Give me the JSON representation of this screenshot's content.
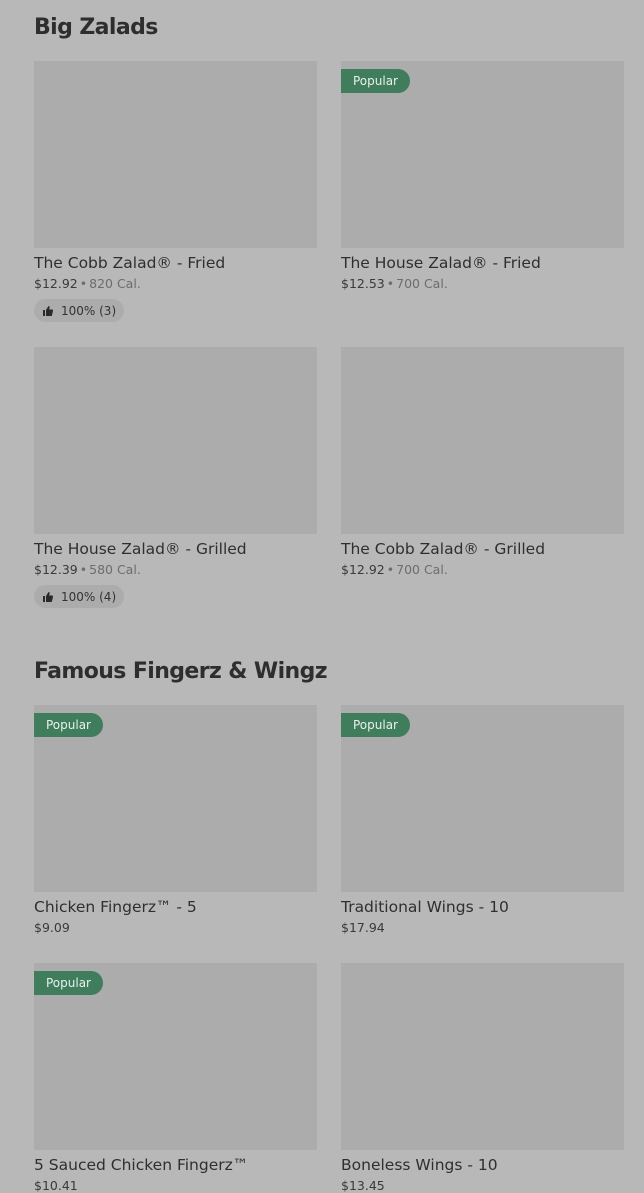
{
  "sections": [
    {
      "title": "Big Zalads",
      "items": [
        {
          "name": "The Cobb Zalad® - Fried",
          "price": "$12.92",
          "calories": "820 Cal.",
          "badge": "",
          "rating": "100% (3)"
        },
        {
          "name": "The House Zalad® - Fried",
          "price": "$12.53",
          "calories": "700 Cal.",
          "badge": "Popular",
          "rating": ""
        },
        {
          "name": "The House Zalad® - Grilled",
          "price": "$12.39",
          "calories": "580 Cal.",
          "badge": "",
          "rating": "100% (4)"
        },
        {
          "name": "The Cobb Zalad® - Grilled",
          "price": "$12.92",
          "calories": "700 Cal.",
          "badge": "",
          "rating": ""
        }
      ]
    },
    {
      "title": "Famous Fingerz & Wingz",
      "items": [
        {
          "name": "Chicken Fingerz™ - 5",
          "price": "$9.09",
          "calories": "",
          "badge": "Popular",
          "rating": ""
        },
        {
          "name": "Traditional Wings - 10",
          "price": "$17.94",
          "calories": "",
          "badge": "Popular",
          "rating": ""
        },
        {
          "name": "5 Sauced Chicken Fingerz™",
          "price": "$10.41",
          "calories": "",
          "badge": "Popular",
          "rating": ""
        },
        {
          "name": "Boneless Wings - 10",
          "price": "$13.45",
          "calories": "",
          "badge": "",
          "rating": ""
        }
      ]
    }
  ],
  "meta_separator": "•",
  "colors": {
    "badge": "#3f7d5c",
    "background": "#b8b8b8",
    "image_placeholder": "#acacac"
  },
  "icons": {
    "rating": "thumbs-up-icon"
  }
}
